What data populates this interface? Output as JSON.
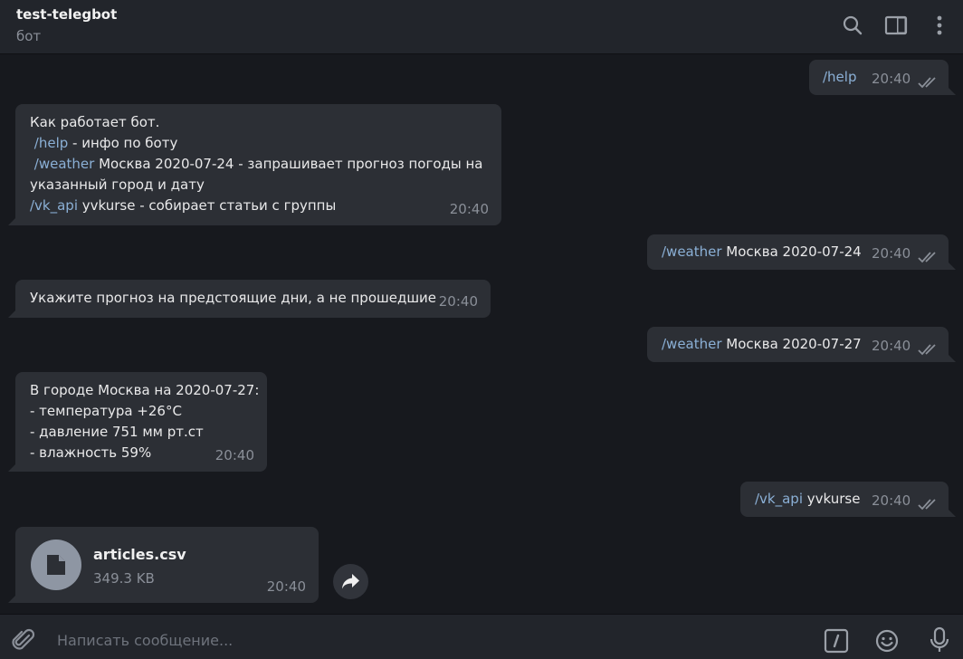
{
  "header": {
    "title": "test-telegbot",
    "subtitle": "бот"
  },
  "messages": {
    "m1": {
      "text": "/help",
      "time": "20:40"
    },
    "m2": {
      "line1": "Как работает бот.",
      "line2_cmd": "/help",
      "line2_text": " - инфо по боту",
      "line3_cmd": "/weather",
      "line3_text": " Москва 2020-07-24 - запрашивает прогноз погоды на",
      "line4": "указанный город и дату",
      "line5_cmd": "/vk_api",
      "line5_text": " yvkurse - собирает статьи с группы",
      "time": "20:40"
    },
    "m3": {
      "cmd": "/weather",
      "text": " Москва 2020-07-24",
      "time": "20:40"
    },
    "m4": {
      "text": "Укажите прогноз на предстоящие дни, а не прошедшие",
      "time": "20:40"
    },
    "m5": {
      "cmd": "/weather",
      "text": " Москва 2020-07-27",
      "time": "20:40"
    },
    "m6": {
      "line1": "В городе Москва на 2020-07-27:",
      "line2": "- температура +26°С",
      "line3": "- давление 751 мм рт.ст",
      "line4": "- влажность 59%",
      "time": "20:40"
    },
    "m7": {
      "cmd": "/vk_api",
      "text": " yvkurse",
      "time": "20:40"
    },
    "m8": {
      "file_name": "articles.csv",
      "file_size": "349.3 KB",
      "time": "20:40"
    }
  },
  "composer": {
    "placeholder": "Написать сообщение..."
  },
  "colors": {
    "background": "#17191e",
    "bubble": "#2c2f35",
    "command_link": "#8bb0d6",
    "muted": "#8a8f98"
  },
  "icons": [
    "search-icon",
    "sidebar-toggle-icon",
    "more-vertical-icon",
    "double-check-icon",
    "file-icon",
    "share-icon",
    "attach-icon",
    "bot-command-icon",
    "emoji-icon",
    "microphone-icon"
  ]
}
